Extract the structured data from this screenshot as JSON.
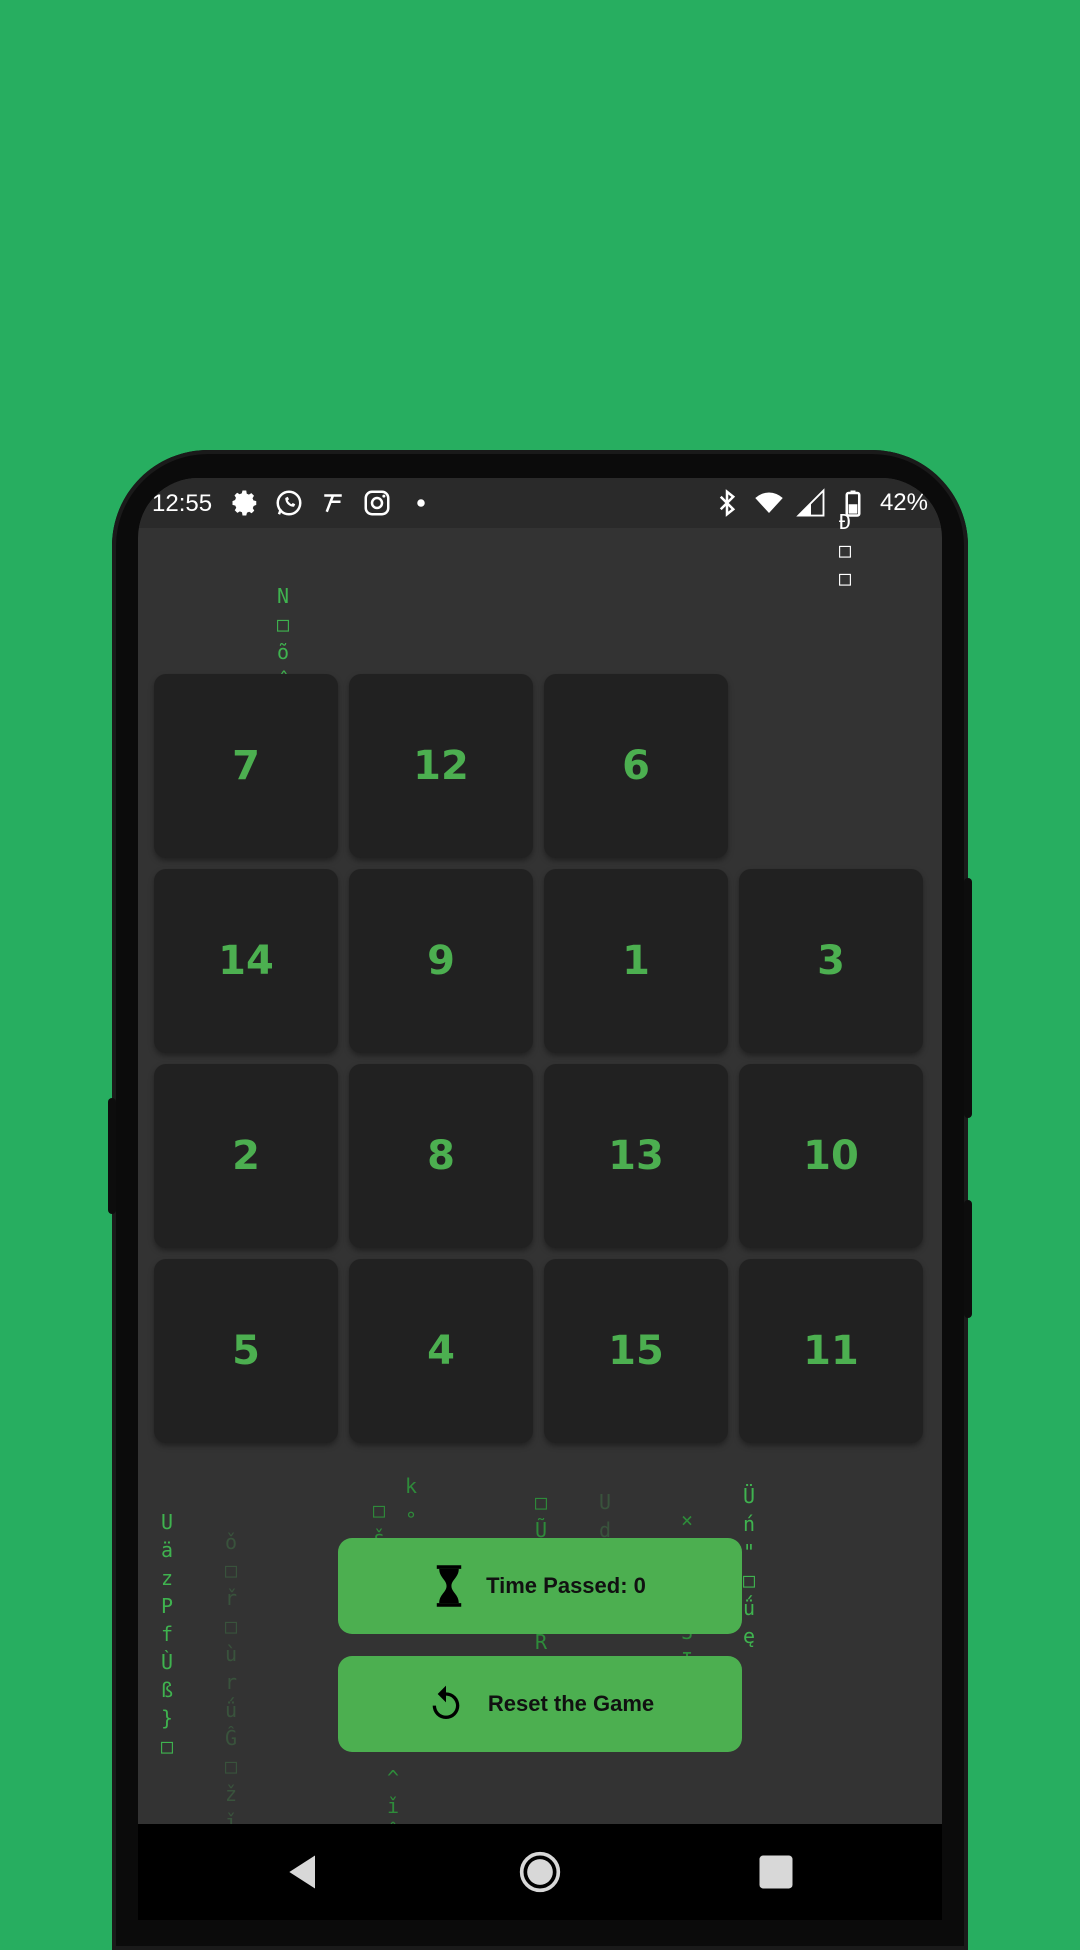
{
  "status_bar": {
    "time": "12:55",
    "battery": "42%",
    "left_icons": [
      "gear-icon",
      "whatsapp-icon",
      "app-icon",
      "instagram-icon",
      "dot-icon"
    ],
    "right_icons": [
      "bluetooth-icon",
      "wifi-icon",
      "signal-icon",
      "battery-icon"
    ]
  },
  "puzzle": {
    "tiles": [
      [
        "7",
        "12",
        "6",
        ""
      ],
      [
        "14",
        "9",
        "1",
        "3"
      ],
      [
        "2",
        "8",
        "13",
        "10"
      ],
      [
        "5",
        "4",
        "15",
        "11"
      ]
    ]
  },
  "controls": {
    "timer_label": "Time Passed: 0",
    "reset_label": "Reset the Game"
  },
  "rain_columns": [
    "U\nä\nz\nP\nf\nÙ\nß\n}\n□",
    "ǒ\n□\nř\n□\nù\nr\nǘ\nĜ\n□\nž\nǐ\nń",
    "N\n□\nõ\nĉ",
    "□\nš\nÑ\n∘",
    "k\n∘",
    "^\nǐ\nŴ",
    "□\nŨ\nț\n□\nû\nR\nû\n□",
    "U\nd\nE\n□\n□",
    "×\n□\nŠ\nĐ\nS\nĮ\nŞ",
    "Ü\nń\n\"\n□\nǘ\nę",
    "Đ\n□\n□"
  ],
  "colors": {
    "background": "#27ae60",
    "screen": "#333333",
    "tile": "#212121",
    "accent": "#4caf50"
  }
}
